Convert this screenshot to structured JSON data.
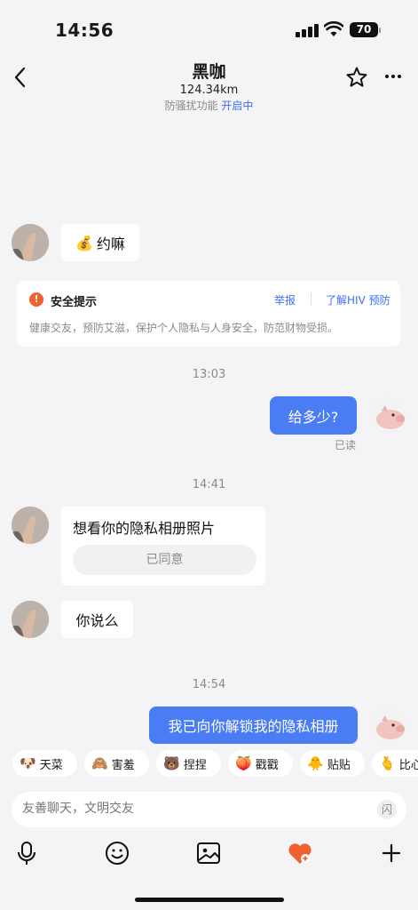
{
  "status": {
    "time": "14:56",
    "battery": "70"
  },
  "header": {
    "title": "黑咖",
    "distance": "124.34km",
    "anti_harass_label": "防骚扰功能",
    "anti_harass_state": "开启中"
  },
  "messages": [
    {
      "side": "left",
      "text": "约嘛",
      "emoji": "💰"
    },
    {
      "side": "right",
      "text": "给多少?",
      "status": "已读"
    },
    {
      "side": "left",
      "text": "想看你的隐私相册照片",
      "button": "已同意"
    },
    {
      "side": "left",
      "text": "你说么"
    },
    {
      "side": "right",
      "text": "我已向你解锁我的隐私相册"
    }
  ],
  "safety_card": {
    "title": "安全提示",
    "report": "举报",
    "hiv": "了解HIV 预防",
    "body": "健康交友，预防艾滋，保护个人隐私与人身安全，防范财物受损。"
  },
  "timestamps": [
    "13:03",
    "14:41",
    "14:54"
  ],
  "reactions": [
    {
      "emoji": "🐶",
      "label": "天菜"
    },
    {
      "emoji": "🙈",
      "label": "害羞"
    },
    {
      "emoji": "🐻",
      "label": "捏捏"
    },
    {
      "emoji": "🍑",
      "label": "戳戳"
    },
    {
      "emoji": "🐥",
      "label": "贴贴"
    },
    {
      "emoji": "🫰",
      "label": "比心"
    }
  ],
  "input": {
    "placeholder": "友善聊天，文明交友",
    "flash": "闪"
  },
  "colors": {
    "accent": "#4a7cf3",
    "warning": "#f0612f",
    "heart": "#f0612f"
  }
}
